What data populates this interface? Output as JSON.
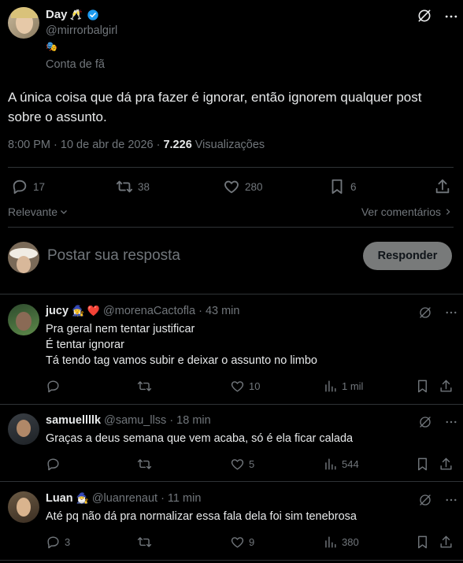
{
  "post": {
    "author_name": "Day",
    "author_emoji": "🥂",
    "handle": "@mirrorbalgirl",
    "bio_emoji": "🎭",
    "bio": "Conta de fã",
    "text": "A única coisa que dá pra fazer é ignorar, então ignorem qualquer post sobre o assunto.",
    "timestamp": "8:00 PM · 10 de abr de 2026 ·",
    "views_count": "7.226",
    "views_label": "Visualizações",
    "replies": "17",
    "reposts": "38",
    "likes": "280",
    "bookmarks": "6"
  },
  "sort": {
    "label": "Relevante",
    "see_comments": "Ver comentários"
  },
  "composer": {
    "placeholder": "Postar sua resposta",
    "button": "Responder"
  },
  "replies": [
    {
      "name": "jucy",
      "emojis": "🧙‍♀️ ❤️",
      "handle": "@morenaCactofla",
      "time": "· 43 min",
      "lines": [
        "Pra geral nem tentar justificar",
        "É tentar ignorar",
        "Tá tendo tag vamos subir e deixar o assunto no limbo"
      ],
      "replies": "",
      "reposts": "",
      "likes": "10",
      "views": "1 mil"
    },
    {
      "name": "samuellllk",
      "emojis": "",
      "handle": "@samu_llss",
      "time": "· 18 min",
      "lines": [
        "Graças a deus semana que vem acaba, só é ela ficar calada"
      ],
      "replies": "",
      "reposts": "",
      "likes": "5",
      "views": "544"
    },
    {
      "name": "Luan",
      "emojis": "🧙‍♂️",
      "handle": "@luanrenaut",
      "time": "· 11 min",
      "lines": [
        "Até pq não dá pra normalizar essa fala dela foi sim tenebrosa"
      ],
      "replies": "3",
      "reposts": "",
      "likes": "9",
      "views": "380"
    }
  ],
  "colors": {
    "background": "#000000",
    "text": "#e7e9ea",
    "muted": "#71767b",
    "border": "#2f3336",
    "verified": "#1d9bf0",
    "heart": "#f91880"
  }
}
